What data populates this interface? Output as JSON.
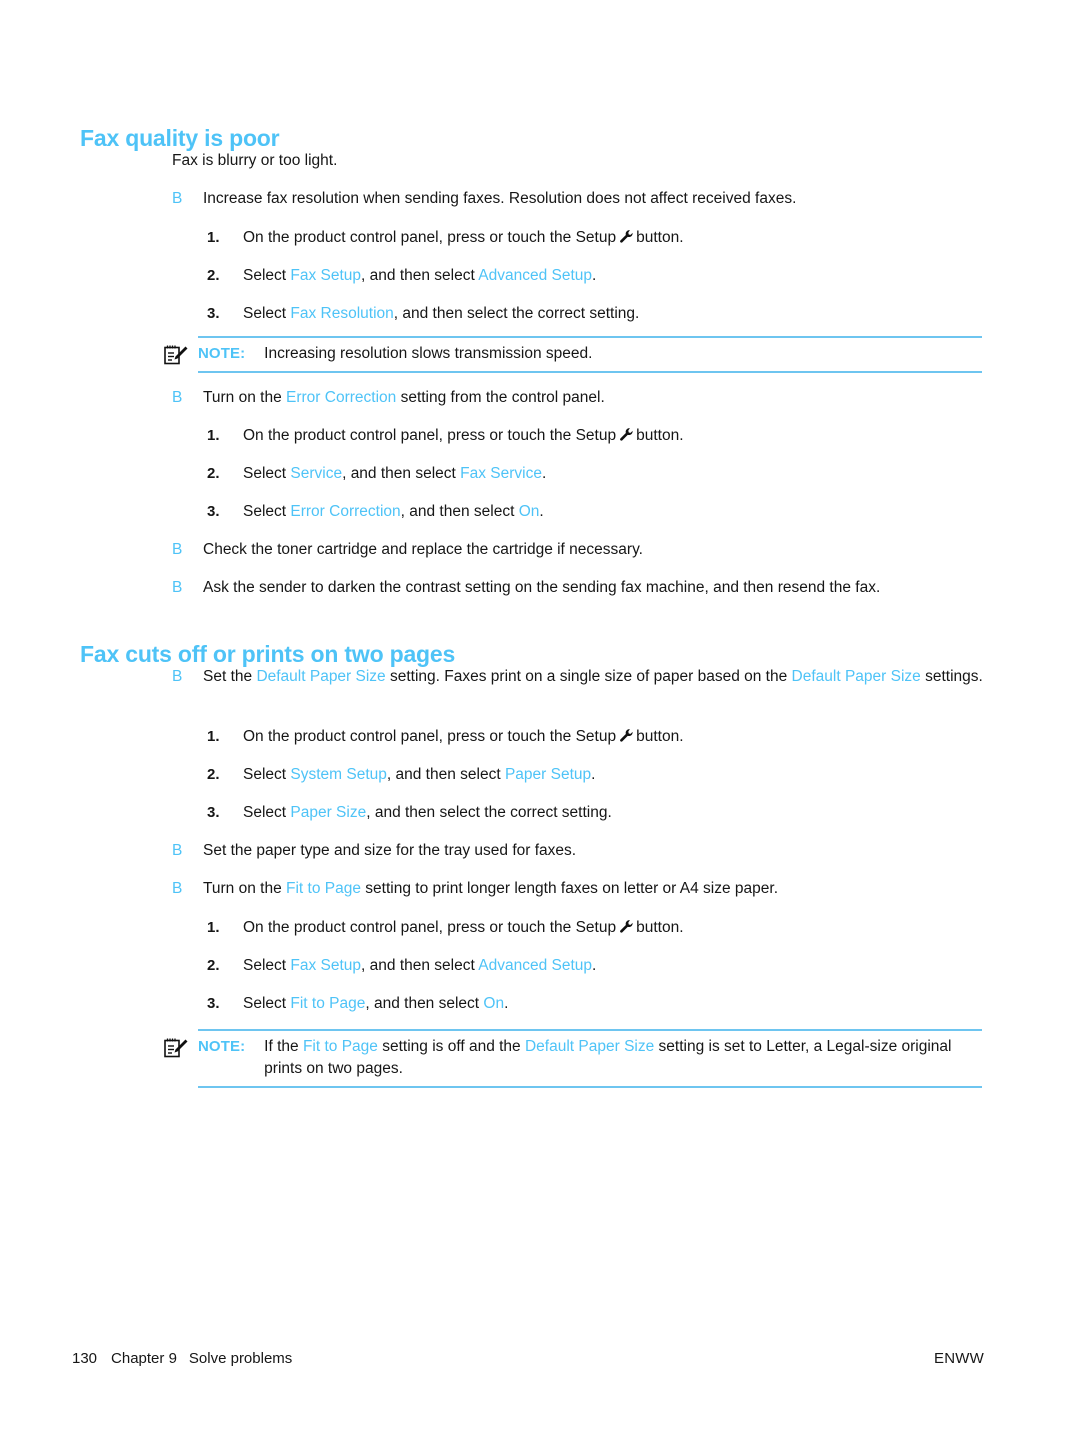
{
  "document": {
    "page_number": "130",
    "chapter": "Chapter 9",
    "chapter_title": "Solve problems",
    "language_code": "ENWW"
  },
  "colors": {
    "accent_cyan": "#4ec3f7",
    "rule_cyan": "#6ec5f0",
    "body_text": "#161616"
  },
  "icons": {
    "setup_wrench": "wrench-icon",
    "note": "note-pad-pencil-icon"
  },
  "sections": [
    {
      "heading": "Fax quality is poor",
      "intro": "Fax is blurry or too light.",
      "bullet_marker": "B"
    },
    {
      "heading": "Fax cuts off or prints on two pages",
      "bullet_marker": "B"
    }
  ],
  "s1": {
    "heading": "Fax quality is poor",
    "intro": "Fax is blurry or too light.",
    "b1": {
      "marker": "B",
      "text": "Increase fax resolution when sending faxes. Resolution does not affect received faxes.",
      "steps": [
        {
          "num": "1.",
          "pre": "On the product control panel, press or touch the Setup",
          "post": "button."
        },
        {
          "num": "2.",
          "pre": "Select ",
          "link1": "Fax Setup",
          "mid": ", and then select ",
          "link2": "Advanced Setup",
          "post": "."
        },
        {
          "num": "3.",
          "pre": "Select ",
          "link1": "Fax Resolution",
          "mid": ", and then select the correct setting.",
          "link2": "",
          "post": ""
        }
      ]
    },
    "note1": {
      "label": "NOTE:",
      "text": "Increasing resolution slows transmission speed."
    },
    "b2": {
      "marker": "B",
      "pre": "Turn on the ",
      "link": "Error Correction",
      "post": " setting from the control panel.",
      "steps": [
        {
          "num": "1.",
          "pre": "On the product control panel, press or touch the Setup",
          "post": "button."
        },
        {
          "num": "2.",
          "pre": "Select ",
          "link1": "Service",
          "mid": ", and then select ",
          "link2": "Fax Service",
          "post": "."
        },
        {
          "num": "3.",
          "pre": "Select ",
          "link1": "Error Correction",
          "mid": ", and then select ",
          "link2": "On",
          "post": "."
        }
      ]
    },
    "b3": {
      "marker": "B",
      "text": "Check the toner cartridge and replace the cartridge if necessary."
    },
    "b4": {
      "marker": "B",
      "text": "Ask the sender to darken the contrast setting on the sending fax machine, and then resend the fax."
    }
  },
  "s2": {
    "heading": "Fax cuts off or prints on two pages",
    "b1": {
      "marker": "B",
      "pre": "Set the ",
      "link1": "Default Paper Size",
      "mid": " setting. Faxes print on a single size of paper based on the ",
      "link2": "Default Paper Size",
      "post": " settings.",
      "steps": [
        {
          "num": "1.",
          "pre": "On the product control panel, press or touch the Setup",
          "post": "button."
        },
        {
          "num": "2.",
          "pre": "Select ",
          "link1": "System Setup",
          "mid": ", and then select ",
          "link2": "Paper Setup",
          "post": "."
        },
        {
          "num": "3.",
          "pre": "Select ",
          "link1": "Paper Size",
          "mid": ", and then select the correct setting.",
          "link2": "",
          "post": ""
        }
      ]
    },
    "b2": {
      "marker": "B",
      "text": "Set the paper type and size for the tray used for faxes."
    },
    "b3": {
      "marker": "B",
      "pre": "Turn on the ",
      "link": "Fit to Page",
      "post": " setting to print longer length faxes on letter or A4 size paper.",
      "steps": [
        {
          "num": "1.",
          "pre": "On the product control panel, press or touch the Setup",
          "post": "button."
        },
        {
          "num": "2.",
          "pre": "Select ",
          "link1": "Fax Setup",
          "mid": ", and then select ",
          "link2": "Advanced Setup",
          "post": "."
        },
        {
          "num": "3.",
          "pre": "Select ",
          "link1": "Fit to Page",
          "mid": ", and then select ",
          "link2": "On",
          "post": "."
        }
      ]
    },
    "note1": {
      "label": "NOTE:",
      "pre": "If the ",
      "link1": "Fit to Page",
      "mid": " setting is off and the ",
      "link2": "Default Paper Size",
      "post": " setting is set to Letter, a Legal-size original prints on two pages."
    }
  }
}
